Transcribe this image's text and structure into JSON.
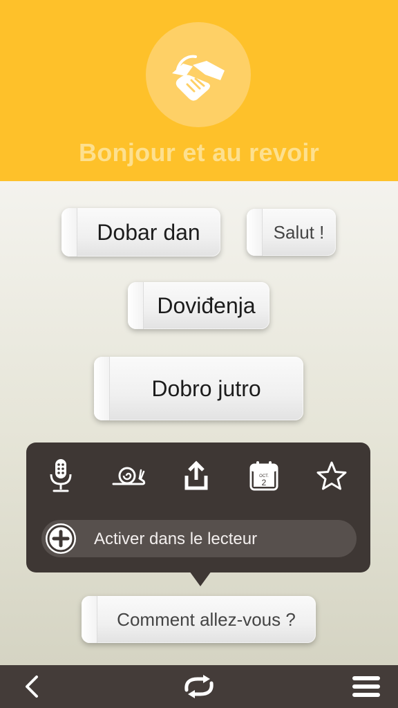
{
  "header": {
    "title": "Bonjour et au revoir",
    "icon": "handshake-icon",
    "background": "#fec12a"
  },
  "phrases": [
    {
      "text": "Dobar dan"
    },
    {
      "text": "Salut !"
    },
    {
      "text": "Doviđenja"
    },
    {
      "text": "Dobro jutro"
    },
    {
      "text": "Comment allez-vous ?"
    }
  ],
  "popup": {
    "tools": [
      {
        "name": "microphone-icon"
      },
      {
        "name": "snail-icon"
      },
      {
        "name": "share-icon"
      },
      {
        "name": "calendar-icon",
        "month": "OCT.",
        "day": "2"
      },
      {
        "name": "star-icon"
      }
    ],
    "activate_label": "Activer dans le lecteur",
    "background": "#3e3734"
  },
  "footer": {
    "back_icon": "chevron-left-icon",
    "repeat_icon": "repeat-icon",
    "menu_icon": "menu-icon",
    "background": "#443c39"
  }
}
